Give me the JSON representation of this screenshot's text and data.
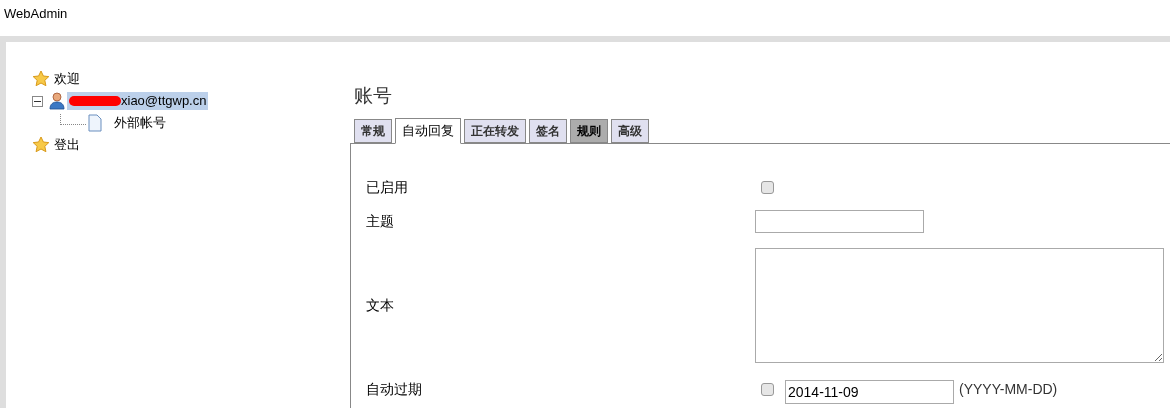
{
  "window": {
    "title": "WebAdmin"
  },
  "tree": [
    {
      "label": "欢迎",
      "kind": "star"
    },
    {
      "label": "xiao@ttgwp.cn",
      "kind": "user",
      "expanded": true,
      "selected": true,
      "redacted": true,
      "children": [
        {
          "label": "外部帐号",
          "kind": "page"
        }
      ]
    },
    {
      "label": "登出",
      "kind": "star"
    }
  ],
  "heading": "账号",
  "tabs": [
    {
      "label": "常规",
      "selected": false,
      "hovered": false
    },
    {
      "label": "自动回复",
      "selected": true,
      "hovered": false
    },
    {
      "label": "正在转发",
      "selected": false,
      "hovered": false
    },
    {
      "label": "签名",
      "selected": false,
      "hovered": false
    },
    {
      "label": "规则",
      "selected": false,
      "hovered": true
    },
    {
      "label": "高级",
      "selected": false,
      "hovered": false
    }
  ],
  "form": [
    {
      "label": "已启用",
      "kind": "checkbox",
      "checked": false
    },
    {
      "label": "主题",
      "kind": "text"
    },
    {
      "label": "文本",
      "kind": "textarea"
    },
    {
      "label": "自动过期",
      "kind": "date",
      "checked": false,
      "value": "2014-11-09",
      "hint": "(YYYY-MM-DD)"
    }
  ]
}
